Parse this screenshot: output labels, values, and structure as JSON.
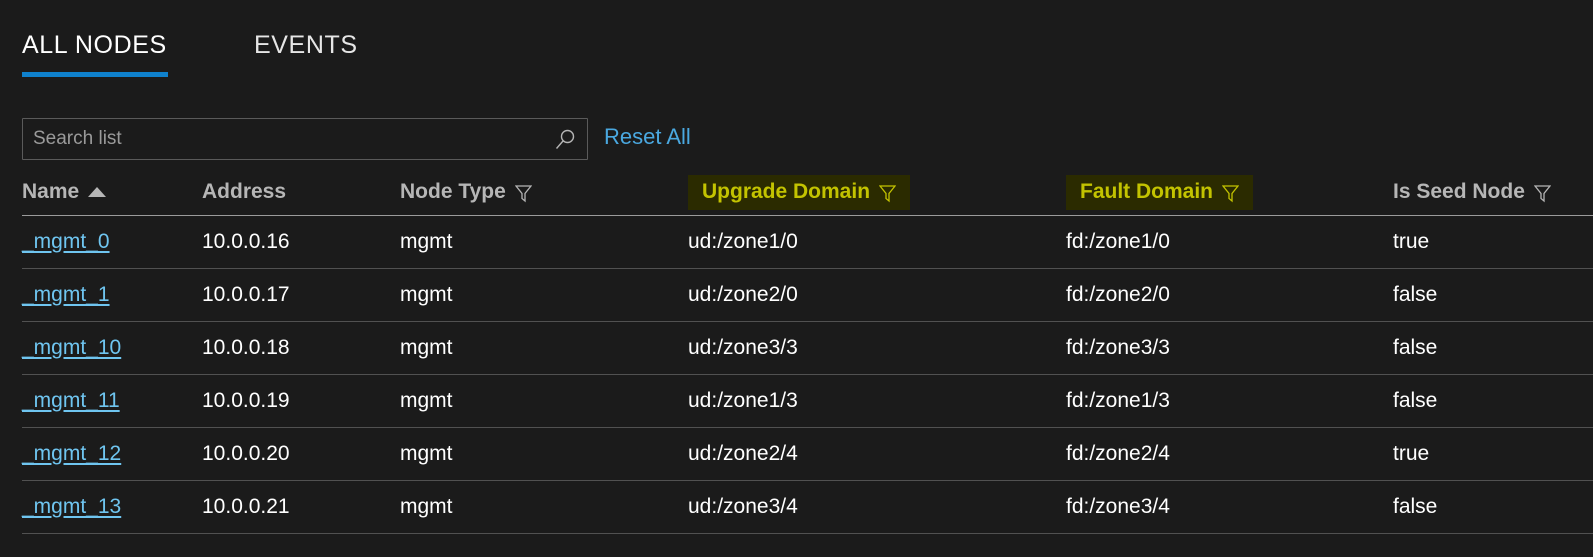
{
  "tabs": [
    {
      "label": "ALL NODES",
      "active": true
    },
    {
      "label": "EVENTS",
      "active": false
    }
  ],
  "search": {
    "placeholder": "Search list",
    "value": "",
    "icon": "search-icon",
    "reset_label": "Reset All"
  },
  "table": {
    "columns": [
      {
        "label": "Name",
        "sort": "ascending",
        "filter": false,
        "highlighted": false
      },
      {
        "label": "Address",
        "sort": null,
        "filter": false,
        "highlighted": false
      },
      {
        "label": "Node Type",
        "sort": null,
        "filter": true,
        "highlighted": false
      },
      {
        "label": "Upgrade Domain",
        "sort": null,
        "filter": true,
        "highlighted": true
      },
      {
        "label": "Fault Domain",
        "sort": null,
        "filter": true,
        "highlighted": true
      },
      {
        "label": "Is Seed Node",
        "sort": null,
        "filter": true,
        "highlighted": false
      }
    ],
    "rows": [
      {
        "name": "_mgmt_0",
        "address": "10.0.0.16",
        "node_type": "mgmt",
        "upgrade_domain": "ud:/zone1/0",
        "fault_domain": "fd:/zone1/0",
        "is_seed_node": "true"
      },
      {
        "name": "_mgmt_1",
        "address": "10.0.0.17",
        "node_type": "mgmt",
        "upgrade_domain": "ud:/zone2/0",
        "fault_domain": "fd:/zone2/0",
        "is_seed_node": "false"
      },
      {
        "name": "_mgmt_10",
        "address": "10.0.0.18",
        "node_type": "mgmt",
        "upgrade_domain": "ud:/zone3/3",
        "fault_domain": "fd:/zone3/3",
        "is_seed_node": "false"
      },
      {
        "name": "_mgmt_11",
        "address": "10.0.0.19",
        "node_type": "mgmt",
        "upgrade_domain": "ud:/zone1/3",
        "fault_domain": "fd:/zone1/3",
        "is_seed_node": "false"
      },
      {
        "name": "_mgmt_12",
        "address": "10.0.0.20",
        "node_type": "mgmt",
        "upgrade_domain": "ud:/zone2/4",
        "fault_domain": "fd:/zone2/4",
        "is_seed_node": "true"
      },
      {
        "name": "_mgmt_13",
        "address": "10.0.0.21",
        "node_type": "mgmt",
        "upgrade_domain": "ud:/zone3/4",
        "fault_domain": "fd:/zone3/4",
        "is_seed_node": "false"
      }
    ]
  },
  "colors": {
    "background": "#1b1b1b",
    "accent_tab_underline": "#0f81cd",
    "link": "#6fc5f0",
    "highlight_text": "#c3c300",
    "highlight_background": "#2b2b00",
    "header_text": "#b6b6b6",
    "row_separator": "#515151"
  }
}
